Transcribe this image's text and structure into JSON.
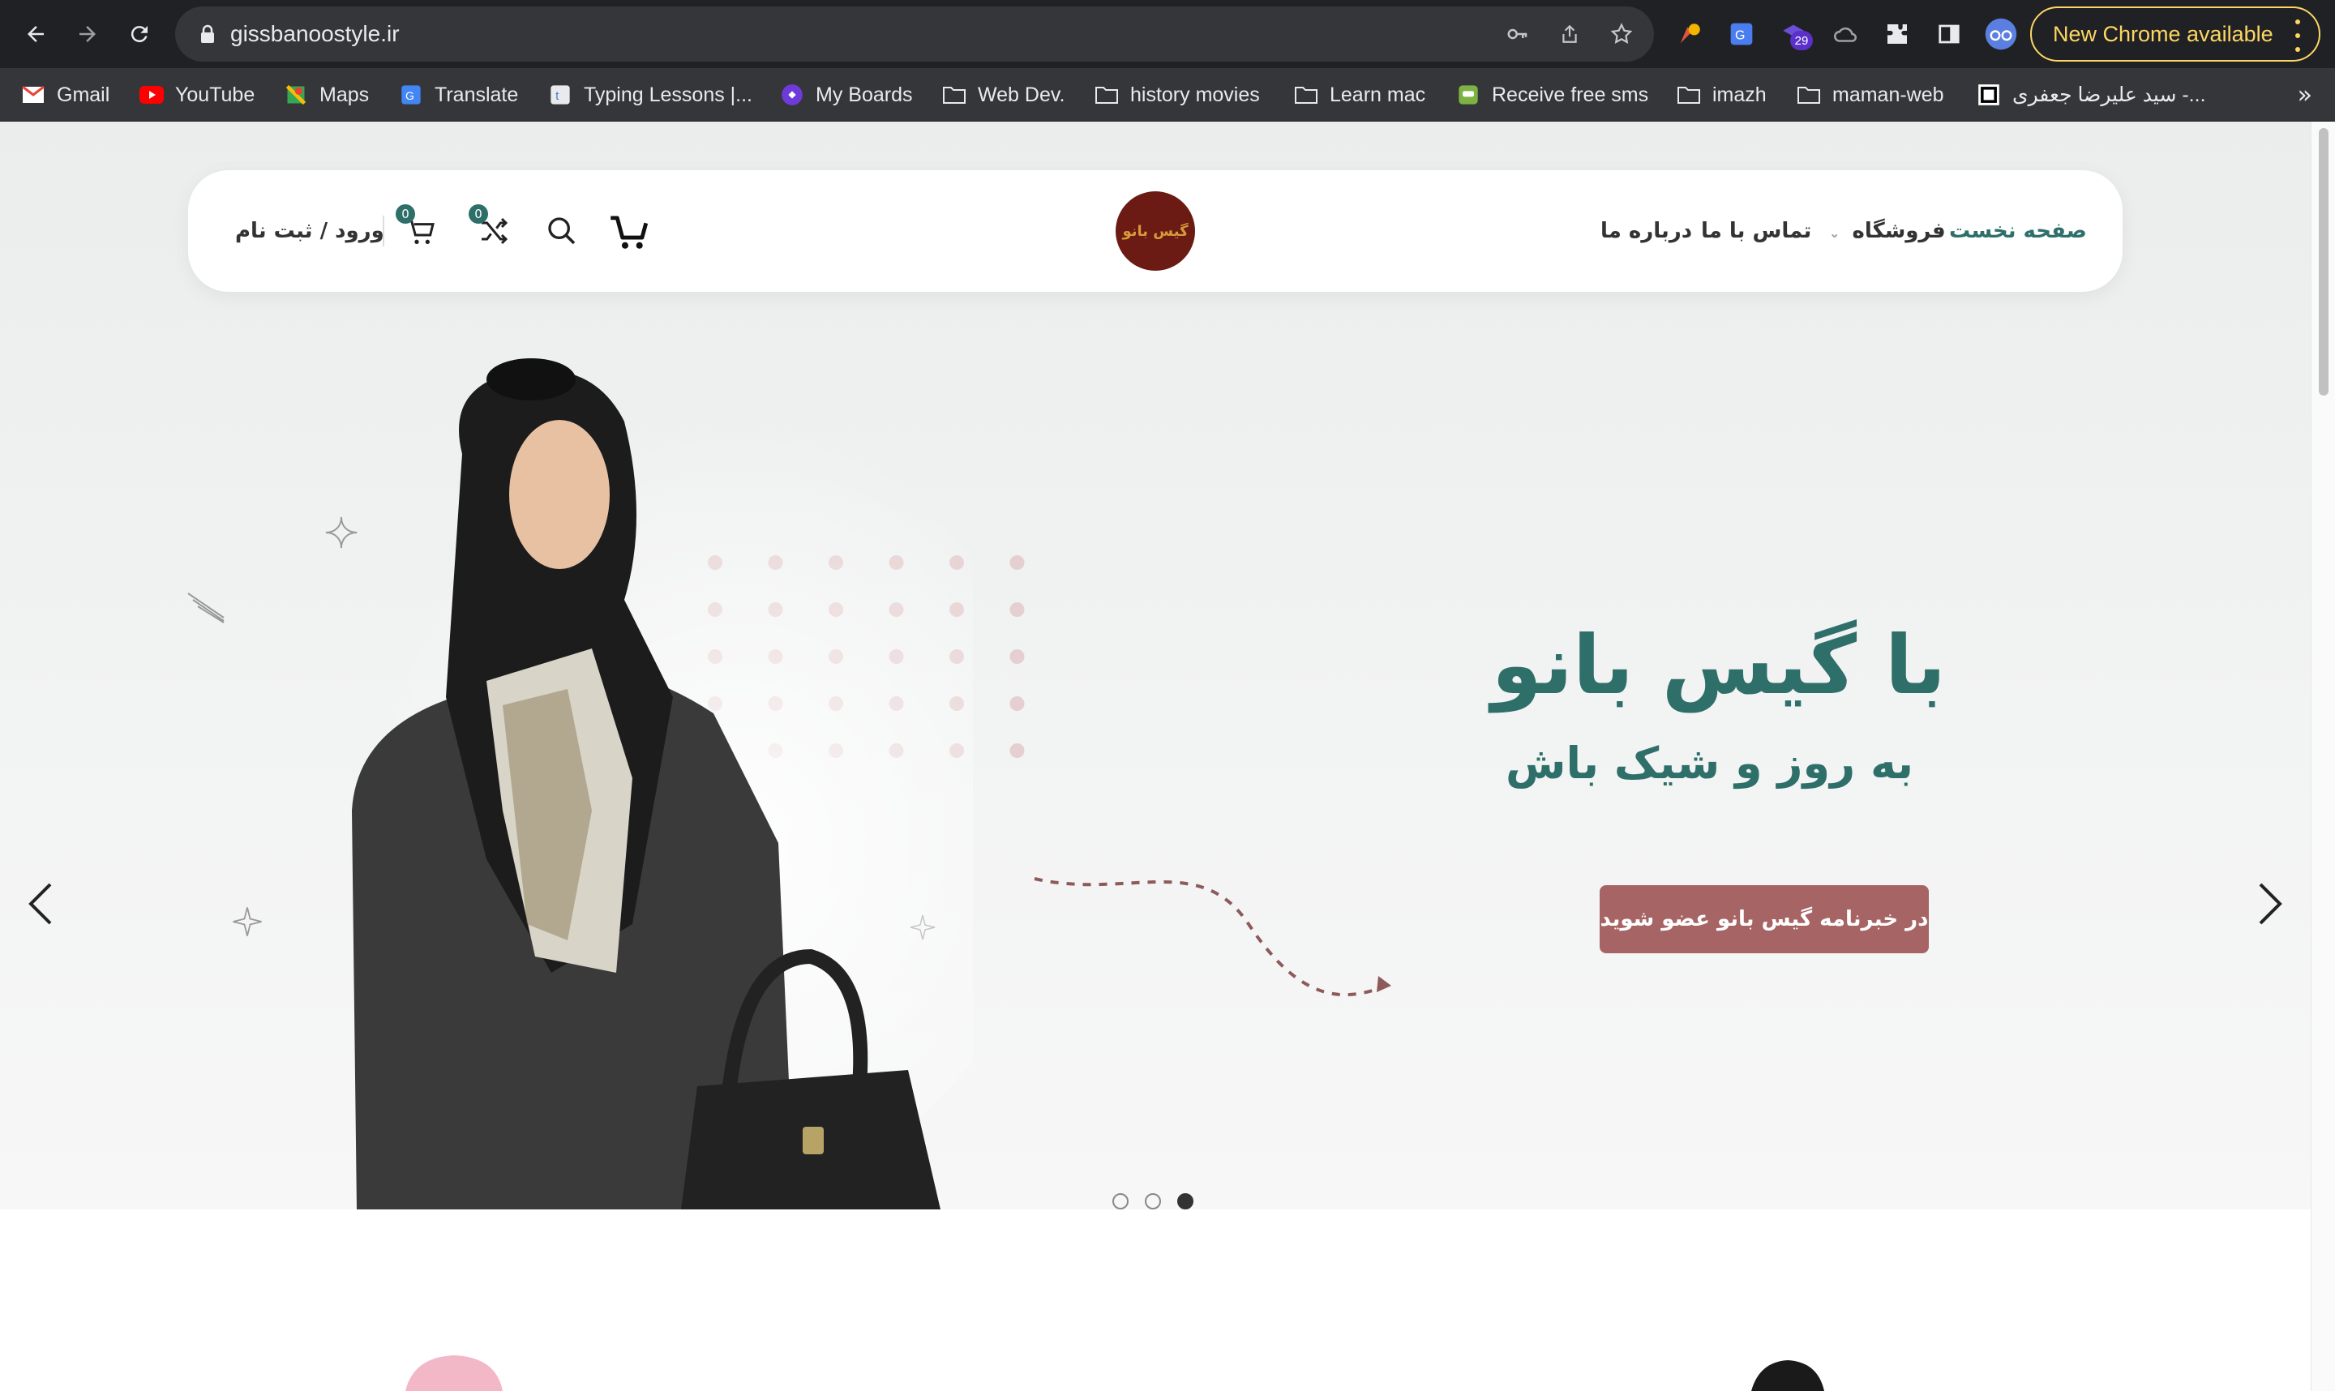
{
  "browser": {
    "url": "gissbanoostyle.ir",
    "update_label": "New Chrome available",
    "extension_badge": "29",
    "bookmarks": [
      {
        "label": "Gmail",
        "icon": "gmail-icon"
      },
      {
        "label": "YouTube",
        "icon": "youtube-icon"
      },
      {
        "label": "Maps",
        "icon": "maps-icon"
      },
      {
        "label": "Translate",
        "icon": "translate-icon"
      },
      {
        "label": "Typing Lessons |...",
        "icon": "typing-icon"
      },
      {
        "label": "My Boards",
        "icon": "boards-icon"
      },
      {
        "label": "Web Dev.",
        "icon": "folder-icon"
      },
      {
        "label": "history movies",
        "icon": "folder-icon"
      },
      {
        "label": "Learn mac",
        "icon": "folder-icon"
      },
      {
        "label": "Receive free sms",
        "icon": "sms-icon"
      },
      {
        "label": "imazh",
        "icon": "folder-icon"
      },
      {
        "label": "maman-web",
        "icon": "folder-icon"
      },
      {
        "label": "سید علیرضا جعفری -...",
        "icon": "square-icon"
      }
    ],
    "bookmarks_more": "»"
  },
  "header": {
    "nav": {
      "home": "صفحه نخست",
      "shop": "فروشگاه",
      "contact": "تماس با ما",
      "about": "درباره ما"
    },
    "logo_text": "گیس بانو",
    "login": "ورود / ثبت نام",
    "cart_count": "0",
    "compare_count": "0"
  },
  "hero": {
    "headline": "با گیس بانو",
    "subline": "به روز و شیک باش",
    "cta": "در خبرنامه گیس بانو عضو شوید",
    "slides": 3,
    "active_slide": 3
  },
  "colors": {
    "brand": "#2e6f6a",
    "cta": "#a66465",
    "logo_bg": "#6b1a14"
  }
}
